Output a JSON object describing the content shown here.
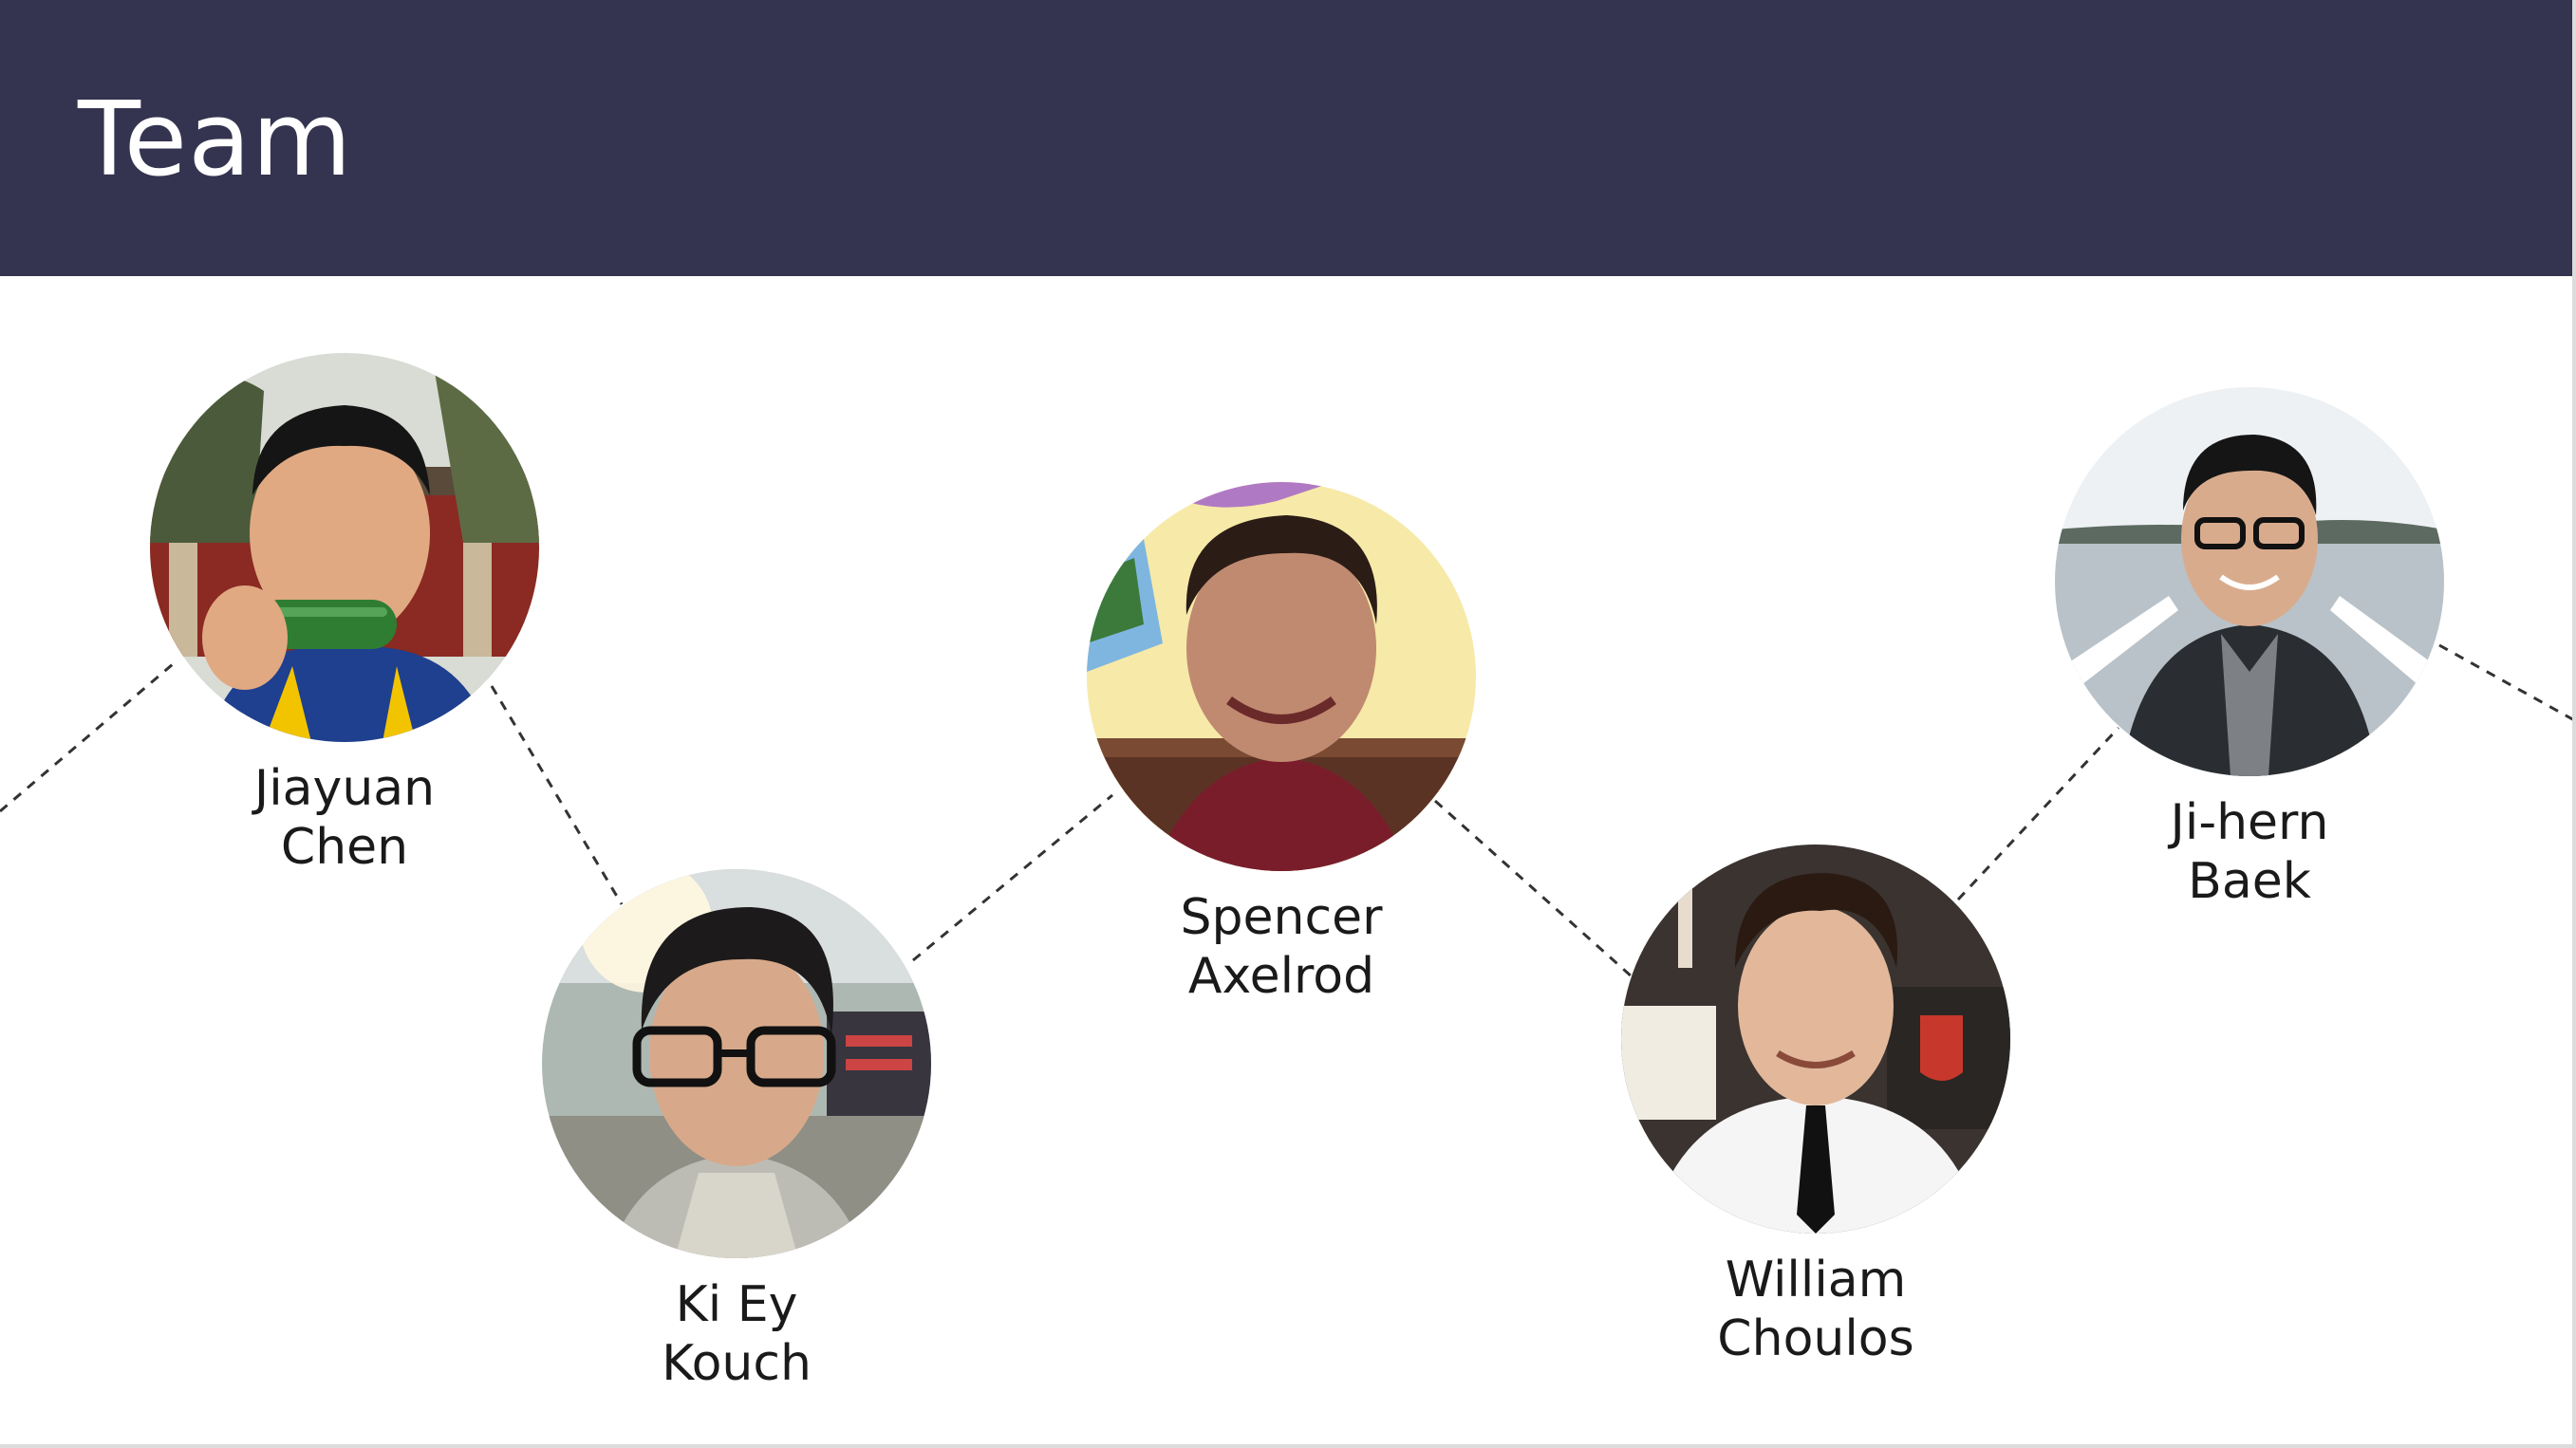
{
  "slide": {
    "title": "Team",
    "header_color": "#343450",
    "connector_style": "dashed"
  },
  "team": [
    {
      "first_name": "Jiayuan",
      "last_name": "Chen",
      "photo": "portrait-photo"
    },
    {
      "first_name": "Ki Ey",
      "last_name": "Kouch",
      "photo": "portrait-photo"
    },
    {
      "first_name": "Spencer",
      "last_name": "Axelrod",
      "photo": "portrait-photo"
    },
    {
      "first_name": "William",
      "last_name": "Choulos",
      "photo": "portrait-photo"
    },
    {
      "first_name": "Ji-hern",
      "last_name": "Baek",
      "photo": "portrait-photo"
    }
  ]
}
